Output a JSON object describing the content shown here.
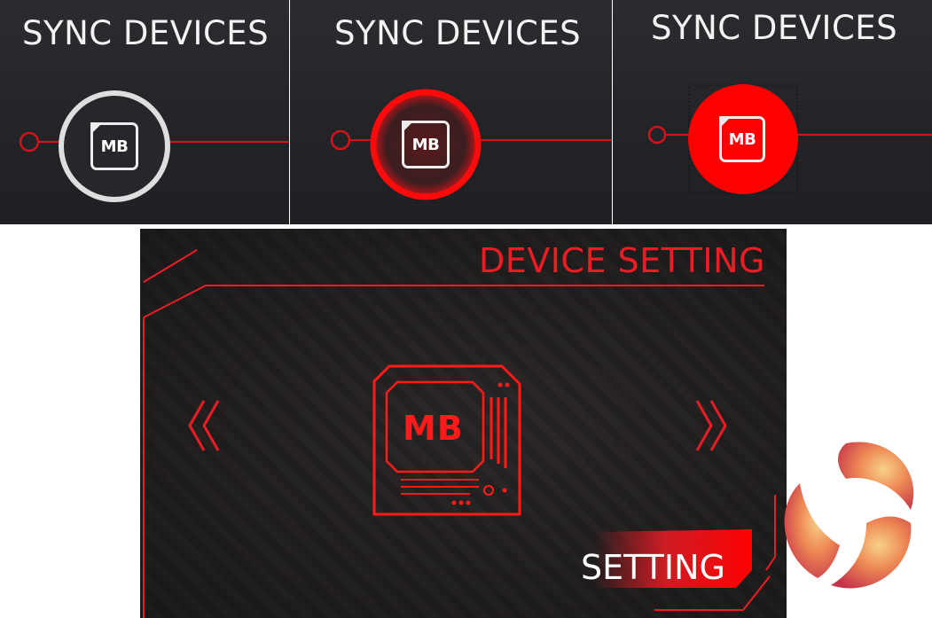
{
  "sync_panels": [
    {
      "title": "SYNC DEVICES",
      "icon_label": "MB",
      "state": "normal"
    },
    {
      "title": "SYNC DEVICES",
      "icon_label": "MB",
      "state": "hover"
    },
    {
      "title": "SYNC DEVICES",
      "icon_label": "MB",
      "state": "selected"
    }
  ],
  "device_setting": {
    "title": "DEVICE SETTING",
    "device_label": "MB",
    "prev_icon": "double-chevron-left-icon",
    "next_icon": "double-chevron-right-icon",
    "setting_label": "SETTING"
  },
  "colors": {
    "accent_red": "#ec1c24",
    "bright_red": "#ff0000",
    "panel_dark": "#232427",
    "text_white": "#f3f3f3"
  }
}
